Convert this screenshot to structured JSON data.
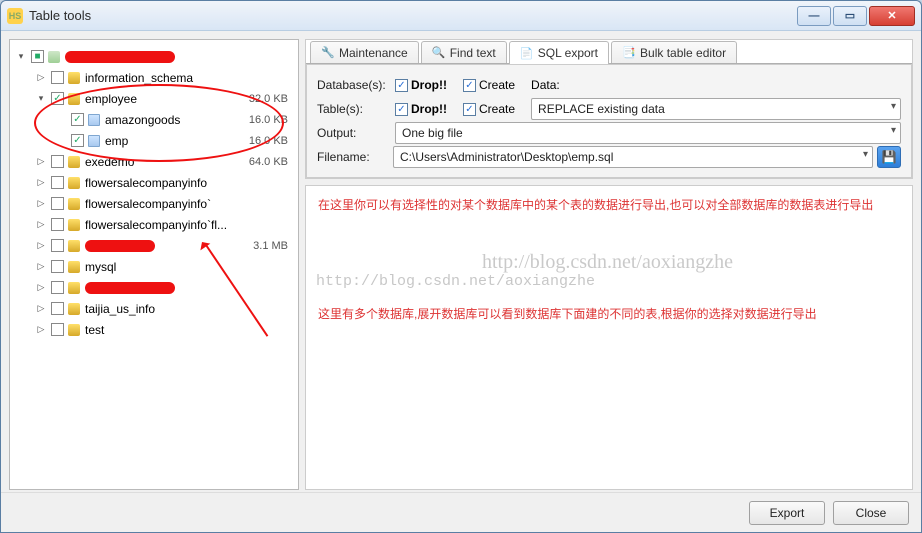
{
  "window": {
    "title": "Table tools"
  },
  "tree": {
    "root_redacted_w": 110,
    "items": [
      {
        "indent": 1,
        "expander": "▷",
        "checked": false,
        "icon": "db",
        "label": "information_schema",
        "size": ""
      },
      {
        "indent": 1,
        "expander": "▾",
        "checked": true,
        "icon": "db",
        "label": "employee",
        "size": "32.0 KB"
      },
      {
        "indent": 2,
        "expander": "",
        "checked": true,
        "icon": "tbl",
        "label": "amazongoods",
        "size": "16.0 KB"
      },
      {
        "indent": 2,
        "expander": "",
        "checked": true,
        "icon": "tbl",
        "label": "emp",
        "size": "16.0 KB"
      },
      {
        "indent": 1,
        "expander": "▷",
        "checked": false,
        "icon": "db",
        "label": "exedemo",
        "size": "64.0 KB"
      },
      {
        "indent": 1,
        "expander": "▷",
        "checked": false,
        "icon": "db",
        "label": "flowersalecompanyinfo",
        "size": ""
      },
      {
        "indent": 1,
        "expander": "▷",
        "checked": false,
        "icon": "db",
        "label": "flowersalecompanyinfo`",
        "size": ""
      },
      {
        "indent": 1,
        "expander": "▷",
        "checked": false,
        "icon": "db",
        "label": "flowersalecompanyinfo`fl...",
        "size": ""
      },
      {
        "indent": 1,
        "expander": "▷",
        "checked": false,
        "icon": "db",
        "redact": 70,
        "size": "3.1 MB"
      },
      {
        "indent": 1,
        "expander": "▷",
        "checked": false,
        "icon": "db",
        "label": "mysql",
        "size": ""
      },
      {
        "indent": 1,
        "expander": "▷",
        "checked": false,
        "icon": "db",
        "redact": 90,
        "size": ""
      },
      {
        "indent": 1,
        "expander": "▷",
        "checked": false,
        "icon": "db",
        "label": "taijia_us_info",
        "size": ""
      },
      {
        "indent": 1,
        "expander": "▷",
        "checked": false,
        "icon": "db",
        "label": "test",
        "size": ""
      }
    ]
  },
  "tabs": [
    {
      "icon": "🔧",
      "label": "Maintenance",
      "active": false
    },
    {
      "icon": "🔍",
      "label": "Find text",
      "active": false
    },
    {
      "icon": "📄",
      "label": "SQL export",
      "active": true
    },
    {
      "icon": "📑",
      "label": "Bulk table editor",
      "active": false
    }
  ],
  "form": {
    "databases_label": "Database(s):",
    "tables_label": "Table(s):",
    "output_label": "Output:",
    "filename_label": "Filename:",
    "drop_label": "Drop!!",
    "create_label": "Create",
    "data_label": "Data:",
    "data_combo": "REPLACE existing data",
    "output_combo": "One big file",
    "filename_value": "C:\\Users\\Administrator\\Desktop\\emp.sql",
    "db_drop_checked": true,
    "db_create_checked": true,
    "tb_drop_checked": true,
    "tb_create_checked": true
  },
  "notes": {
    "line1": "在这里你可以有选择性的对某个数据库中的某个表的数据进行导出,也可以对全部数据库的数据表进行导出",
    "line2": "这里有多个数据库,展开数据库可以看到数据库下面建的不同的表,根据你的选择对数据进行导出",
    "watermark": "http://blog.csdn.net/aoxiangzhe",
    "watermark_mono": "http://blog.csdn.net/aoxiangzhe"
  },
  "buttons": {
    "export": "Export",
    "close": "Close"
  }
}
